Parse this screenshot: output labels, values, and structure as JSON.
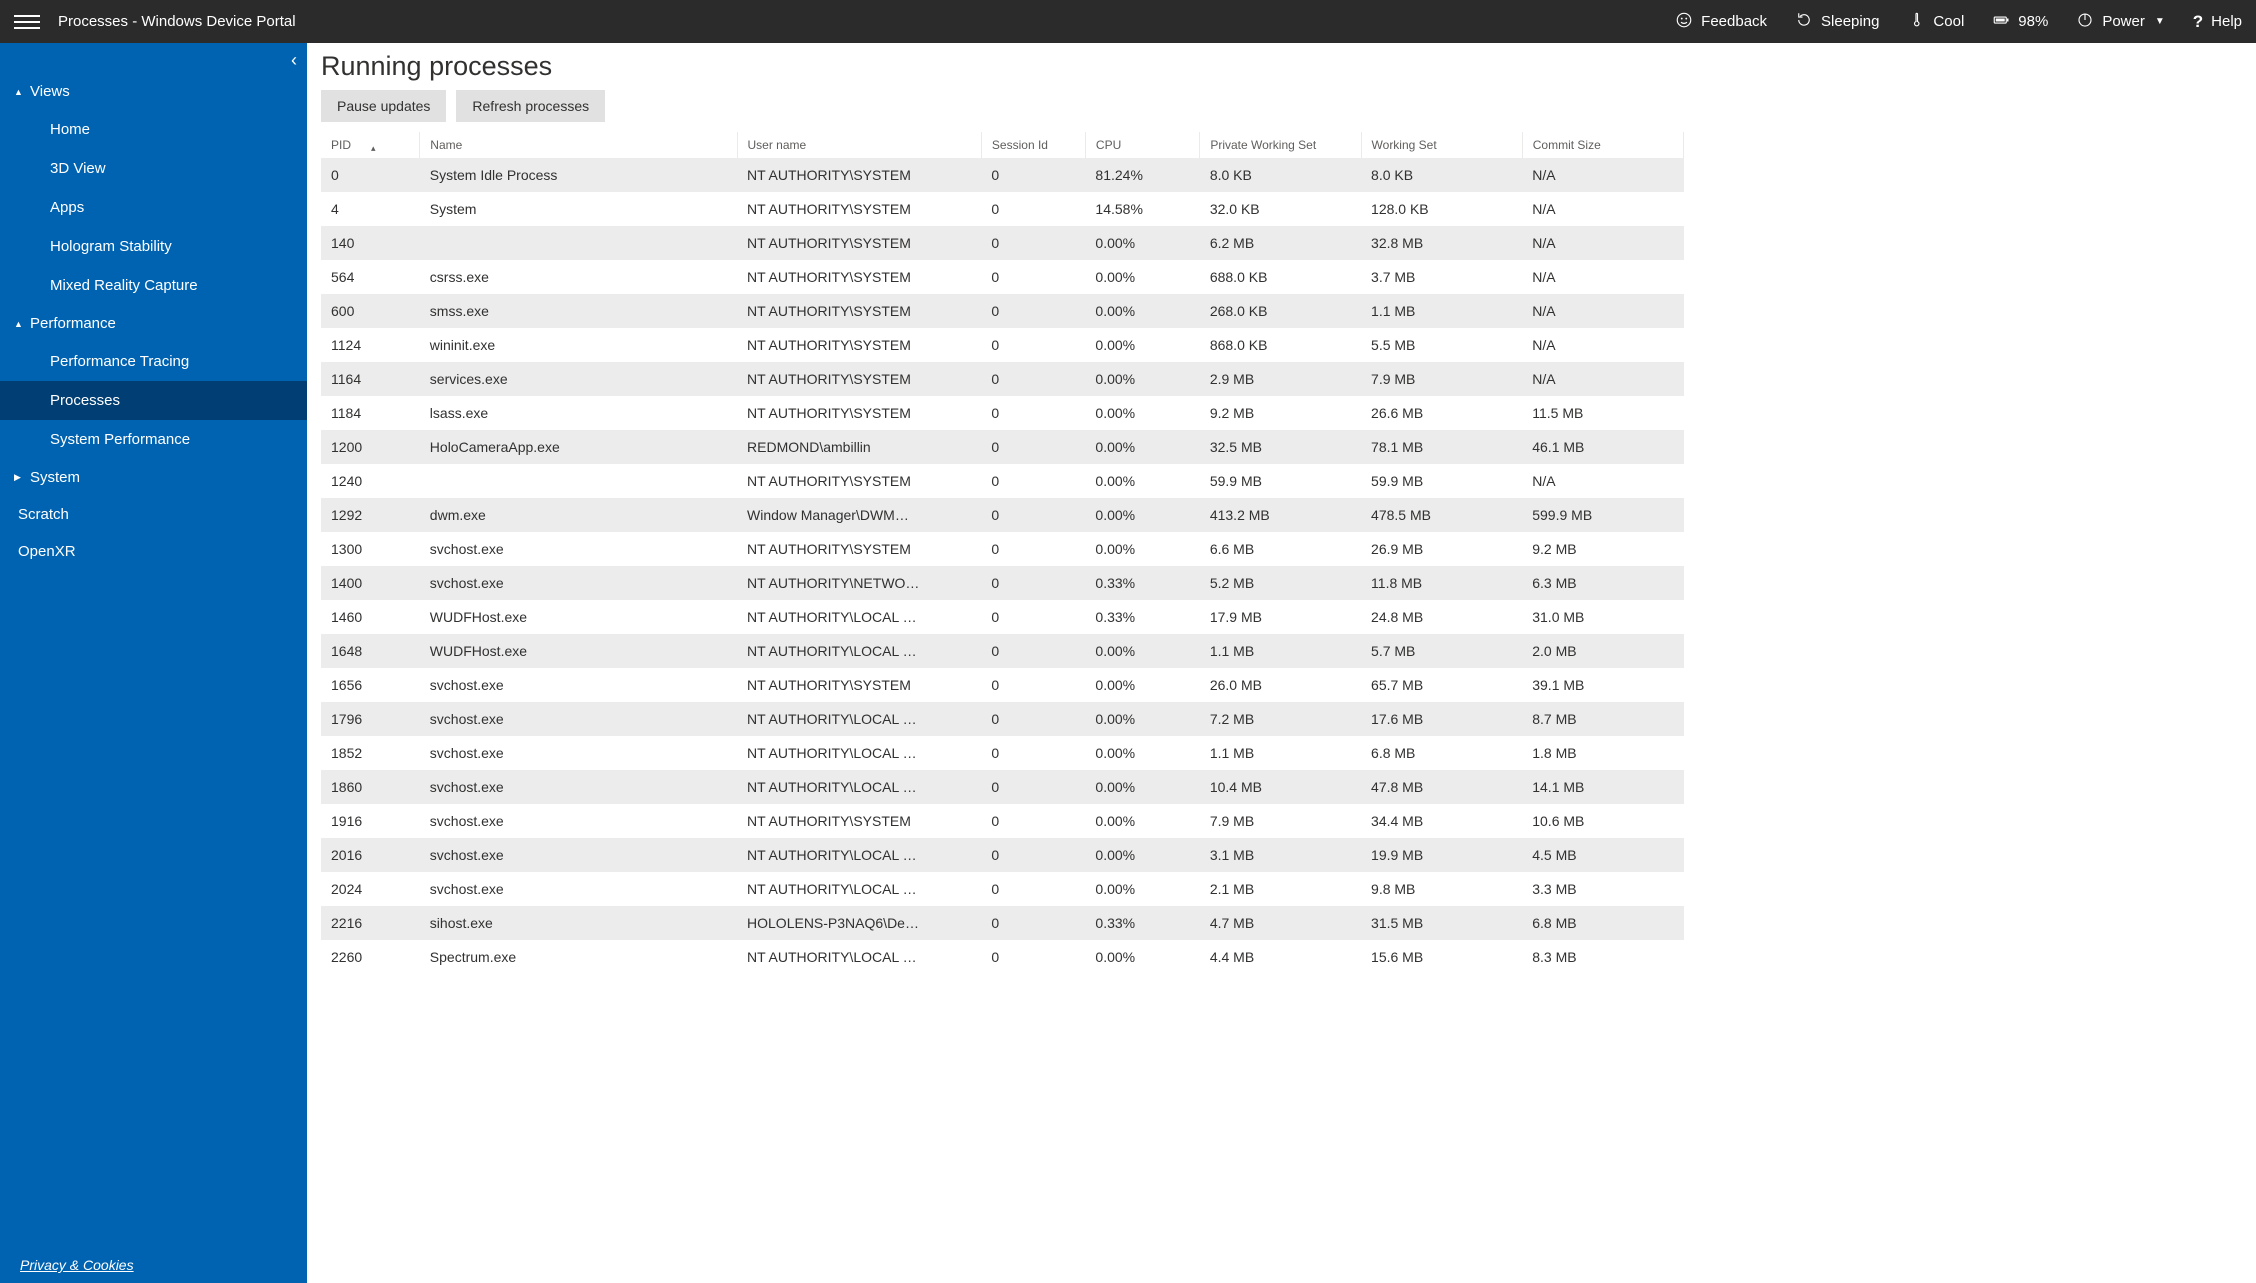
{
  "header": {
    "title": "Processes - Windows Device Portal",
    "actions": {
      "feedback": "Feedback",
      "sleeping": "Sleeping",
      "cool": "Cool",
      "battery": "98%",
      "power": "Power",
      "help": "Help"
    }
  },
  "sidebar": {
    "groups": [
      {
        "label": "Views",
        "expanded": true,
        "items": [
          {
            "label": "Home",
            "active": false
          },
          {
            "label": "3D View",
            "active": false
          },
          {
            "label": "Apps",
            "active": false
          },
          {
            "label": "Hologram Stability",
            "active": false
          },
          {
            "label": "Mixed Reality Capture",
            "active": false
          }
        ]
      },
      {
        "label": "Performance",
        "expanded": true,
        "items": [
          {
            "label": "Performance Tracing",
            "active": false
          },
          {
            "label": "Processes",
            "active": true
          },
          {
            "label": "System Performance",
            "active": false
          }
        ]
      },
      {
        "label": "System",
        "expanded": false,
        "items": []
      }
    ],
    "simple": [
      {
        "label": "Scratch"
      },
      {
        "label": "OpenXR"
      }
    ],
    "footer": "Privacy & Cookies"
  },
  "main": {
    "title": "Running processes",
    "buttons": {
      "pause": "Pause updates",
      "refresh": "Refresh processes"
    },
    "columns": [
      "PID",
      "Name",
      "User name",
      "Session Id",
      "CPU",
      "Private Working Set",
      "Working Set",
      "Commit Size"
    ],
    "sort_col": 0,
    "rows": [
      {
        "pid": "0",
        "name": "System Idle Process",
        "user": "NT AUTHORITY\\SYSTEM",
        "session": "0",
        "cpu": "81.24%",
        "pws": "8.0 KB",
        "ws": "8.0 KB",
        "commit": "N/A"
      },
      {
        "pid": "4",
        "name": "System",
        "user": "NT AUTHORITY\\SYSTEM",
        "session": "0",
        "cpu": "14.58%",
        "pws": "32.0 KB",
        "ws": "128.0 KB",
        "commit": "N/A"
      },
      {
        "pid": "140",
        "name": "",
        "user": "NT AUTHORITY\\SYSTEM",
        "session": "0",
        "cpu": "0.00%",
        "pws": "6.2 MB",
        "ws": "32.8 MB",
        "commit": "N/A"
      },
      {
        "pid": "564",
        "name": "csrss.exe",
        "user": "NT AUTHORITY\\SYSTEM",
        "session": "0",
        "cpu": "0.00%",
        "pws": "688.0 KB",
        "ws": "3.7 MB",
        "commit": "N/A"
      },
      {
        "pid": "600",
        "name": "smss.exe",
        "user": "NT AUTHORITY\\SYSTEM",
        "session": "0",
        "cpu": "0.00%",
        "pws": "268.0 KB",
        "ws": "1.1 MB",
        "commit": "N/A"
      },
      {
        "pid": "1124",
        "name": "wininit.exe",
        "user": "NT AUTHORITY\\SYSTEM",
        "session": "0",
        "cpu": "0.00%",
        "pws": "868.0 KB",
        "ws": "5.5 MB",
        "commit": "N/A"
      },
      {
        "pid": "1164",
        "name": "services.exe",
        "user": "NT AUTHORITY\\SYSTEM",
        "session": "0",
        "cpu": "0.00%",
        "pws": "2.9 MB",
        "ws": "7.9 MB",
        "commit": "N/A"
      },
      {
        "pid": "1184",
        "name": "lsass.exe",
        "user": "NT AUTHORITY\\SYSTEM",
        "session": "0",
        "cpu": "0.00%",
        "pws": "9.2 MB",
        "ws": "26.6 MB",
        "commit": "11.5 MB"
      },
      {
        "pid": "1200",
        "name": "HoloCameraApp.exe",
        "user": "REDMOND\\ambillin",
        "session": "0",
        "cpu": "0.00%",
        "pws": "32.5 MB",
        "ws": "78.1 MB",
        "commit": "46.1 MB"
      },
      {
        "pid": "1240",
        "name": "",
        "user": "NT AUTHORITY\\SYSTEM",
        "session": "0",
        "cpu": "0.00%",
        "pws": "59.9 MB",
        "ws": "59.9 MB",
        "commit": "N/A"
      },
      {
        "pid": "1292",
        "name": "dwm.exe",
        "user": "Window Manager\\DWM…",
        "session": "0",
        "cpu": "0.00%",
        "pws": "413.2 MB",
        "ws": "478.5 MB",
        "commit": "599.9 MB"
      },
      {
        "pid": "1300",
        "name": "svchost.exe",
        "user": "NT AUTHORITY\\SYSTEM",
        "session": "0",
        "cpu": "0.00%",
        "pws": "6.6 MB",
        "ws": "26.9 MB",
        "commit": "9.2 MB"
      },
      {
        "pid": "1400",
        "name": "svchost.exe",
        "user": "NT AUTHORITY\\NETWO…",
        "session": "0",
        "cpu": "0.33%",
        "pws": "5.2 MB",
        "ws": "11.8 MB",
        "commit": "6.3 MB"
      },
      {
        "pid": "1460",
        "name": "WUDFHost.exe",
        "user": "NT AUTHORITY\\LOCAL …",
        "session": "0",
        "cpu": "0.33%",
        "pws": "17.9 MB",
        "ws": "24.8 MB",
        "commit": "31.0 MB"
      },
      {
        "pid": "1648",
        "name": "WUDFHost.exe",
        "user": "NT AUTHORITY\\LOCAL …",
        "session": "0",
        "cpu": "0.00%",
        "pws": "1.1 MB",
        "ws": "5.7 MB",
        "commit": "2.0 MB"
      },
      {
        "pid": "1656",
        "name": "svchost.exe",
        "user": "NT AUTHORITY\\SYSTEM",
        "session": "0",
        "cpu": "0.00%",
        "pws": "26.0 MB",
        "ws": "65.7 MB",
        "commit": "39.1 MB"
      },
      {
        "pid": "1796",
        "name": "svchost.exe",
        "user": "NT AUTHORITY\\LOCAL …",
        "session": "0",
        "cpu": "0.00%",
        "pws": "7.2 MB",
        "ws": "17.6 MB",
        "commit": "8.7 MB"
      },
      {
        "pid": "1852",
        "name": "svchost.exe",
        "user": "NT AUTHORITY\\LOCAL …",
        "session": "0",
        "cpu": "0.00%",
        "pws": "1.1 MB",
        "ws": "6.8 MB",
        "commit": "1.8 MB"
      },
      {
        "pid": "1860",
        "name": "svchost.exe",
        "user": "NT AUTHORITY\\LOCAL …",
        "session": "0",
        "cpu": "0.00%",
        "pws": "10.4 MB",
        "ws": "47.8 MB",
        "commit": "14.1 MB"
      },
      {
        "pid": "1916",
        "name": "svchost.exe",
        "user": "NT AUTHORITY\\SYSTEM",
        "session": "0",
        "cpu": "0.00%",
        "pws": "7.9 MB",
        "ws": "34.4 MB",
        "commit": "10.6 MB"
      },
      {
        "pid": "2016",
        "name": "svchost.exe",
        "user": "NT AUTHORITY\\LOCAL …",
        "session": "0",
        "cpu": "0.00%",
        "pws": "3.1 MB",
        "ws": "19.9 MB",
        "commit": "4.5 MB"
      },
      {
        "pid": "2024",
        "name": "svchost.exe",
        "user": "NT AUTHORITY\\LOCAL …",
        "session": "0",
        "cpu": "0.00%",
        "pws": "2.1 MB",
        "ws": "9.8 MB",
        "commit": "3.3 MB"
      },
      {
        "pid": "2216",
        "name": "sihost.exe",
        "user": "HOLOLENS-P3NAQ6\\De…",
        "session": "0",
        "cpu": "0.33%",
        "pws": "4.7 MB",
        "ws": "31.5 MB",
        "commit": "6.8 MB"
      },
      {
        "pid": "2260",
        "name": "Spectrum.exe",
        "user": "NT AUTHORITY\\LOCAL …",
        "session": "0",
        "cpu": "0.00%",
        "pws": "4.4 MB",
        "ws": "15.6 MB",
        "commit": "8.3 MB"
      }
    ]
  }
}
